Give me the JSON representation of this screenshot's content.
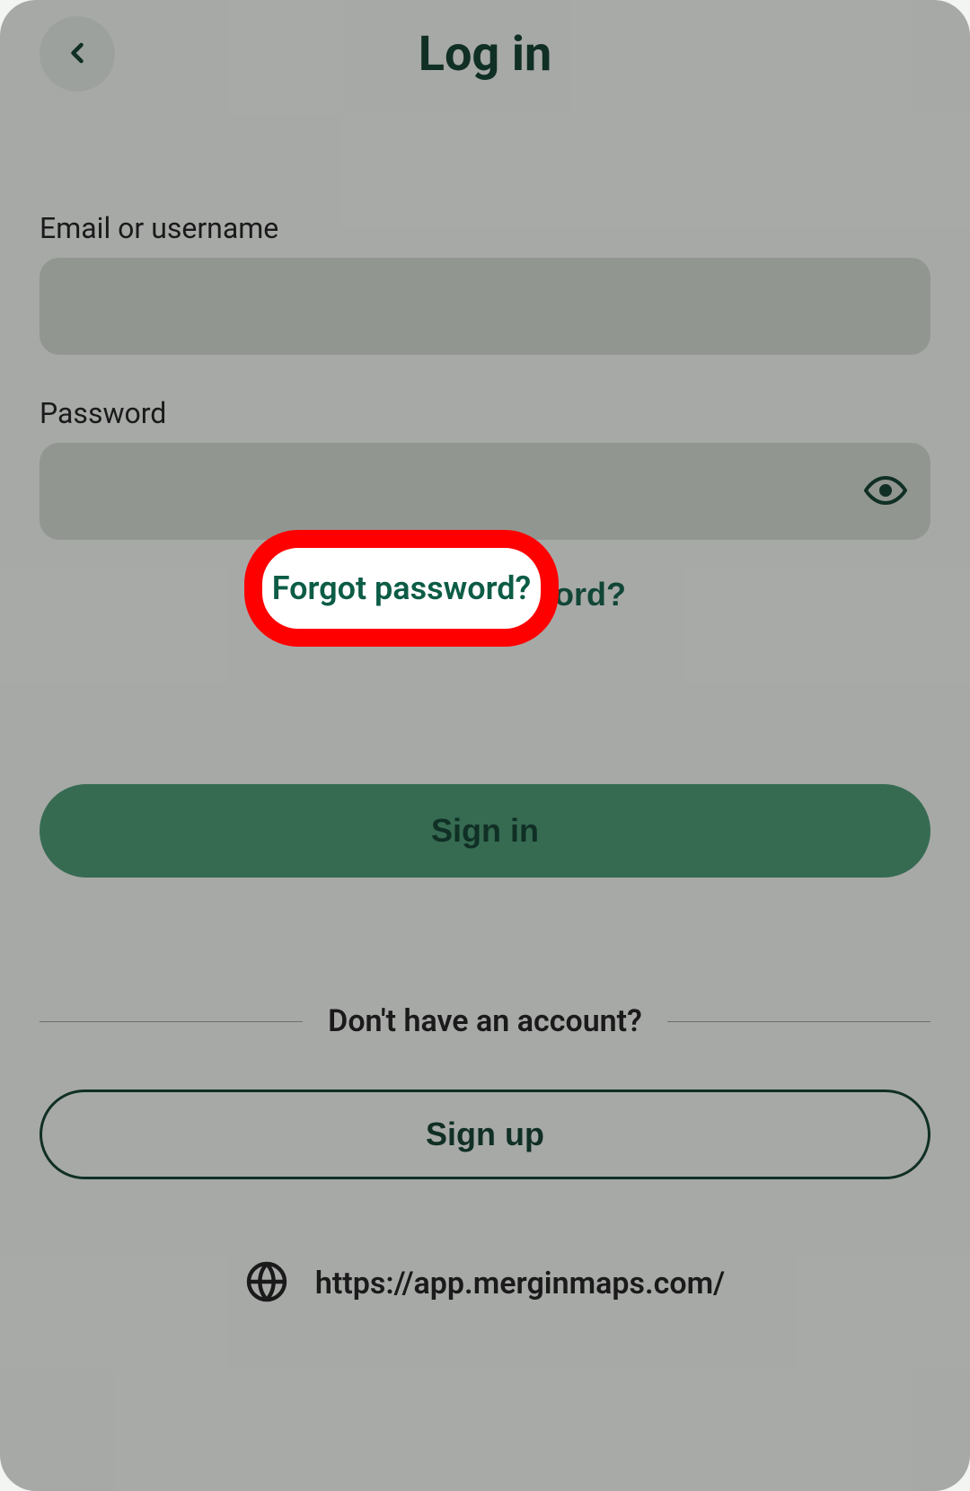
{
  "header": {
    "title": "Log in"
  },
  "form": {
    "email_label": "Email or username",
    "email_value": "",
    "password_label": "Password",
    "password_value": ""
  },
  "links": {
    "forgot": "Forgot password?"
  },
  "buttons": {
    "signin": "Sign in",
    "signup": "Sign up"
  },
  "divider": {
    "text": "Don't have an account?"
  },
  "footer": {
    "url": "https://app.merginmaps.com/"
  },
  "highlight": {
    "text": "Forgot password?"
  }
}
